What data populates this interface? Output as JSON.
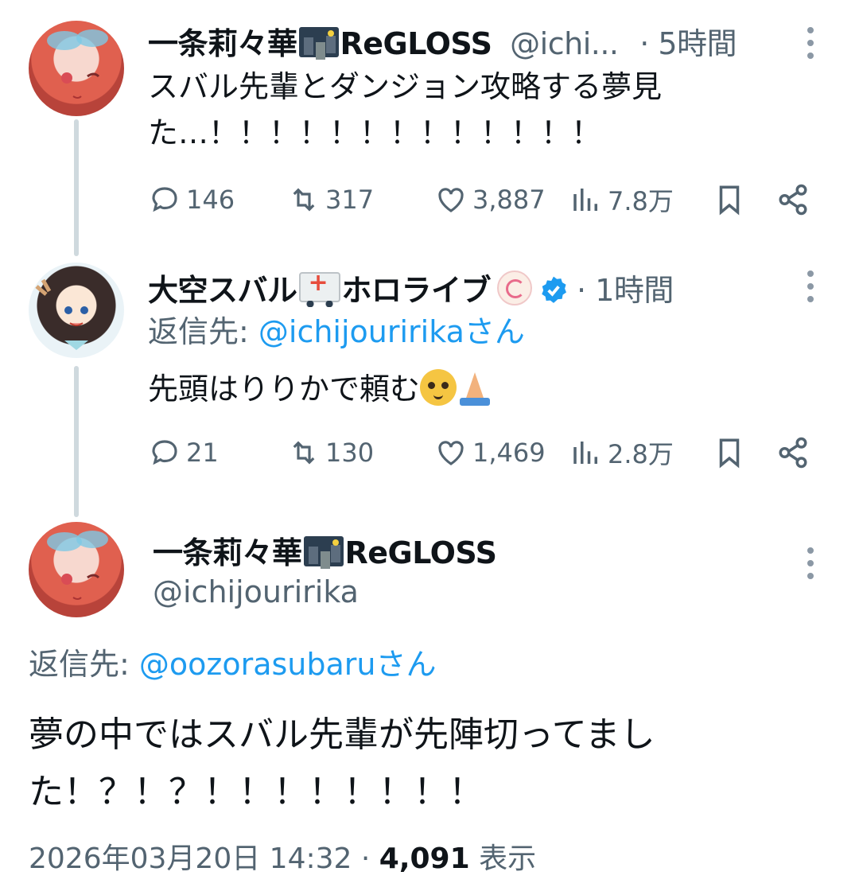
{
  "tweets": [
    {
      "display_name": "一条莉々華",
      "name_suffix": "ReGLOSS",
      "name_emoji": "night-city-emoji",
      "handle": "@ichi...",
      "time": "· 5時間",
      "text_line1": "スバル先輩とダンジョン攻略する夢見",
      "text_line2": "た…！！！！！！！！！！！！！",
      "stats": {
        "replies": "146",
        "retweets": "317",
        "likes": "3,887",
        "views": "7.8万"
      }
    },
    {
      "display_name": "大空スバル",
      "name_suffix": "ホロライブ",
      "name_emoji": "ambulance-emoji",
      "time": "· 1時間",
      "reply_to_label": "返信先: ",
      "reply_to_handle": "@ichijouririka",
      "reply_to_suffix": "さん",
      "text": "先頭はりりかで頼む",
      "stats": {
        "replies": "21",
        "retweets": "130",
        "likes": "1,469",
        "views": "2.8万"
      }
    }
  ],
  "main_tweet": {
    "display_name": "一条莉々華",
    "name_suffix": "ReGLOSS",
    "handle": "@ichijouririka",
    "reply_to_label": "返信先: ",
    "reply_to_handle": "@oozorasubaru",
    "reply_to_suffix": "さん",
    "text_line1": "夢の中ではスバル先輩が先陣切ってまし",
    "text_line2": "た！？！？！！！！！！！！",
    "timestamp": "2026年03月20日 14:32",
    "separator": " · ",
    "view_count": "4,091",
    "view_label": " 表示"
  },
  "colors": {
    "link": "#1d9bf0",
    "verified": "#1d9bf0",
    "secondary": "#536471",
    "thread_line": "#cfd9de"
  }
}
